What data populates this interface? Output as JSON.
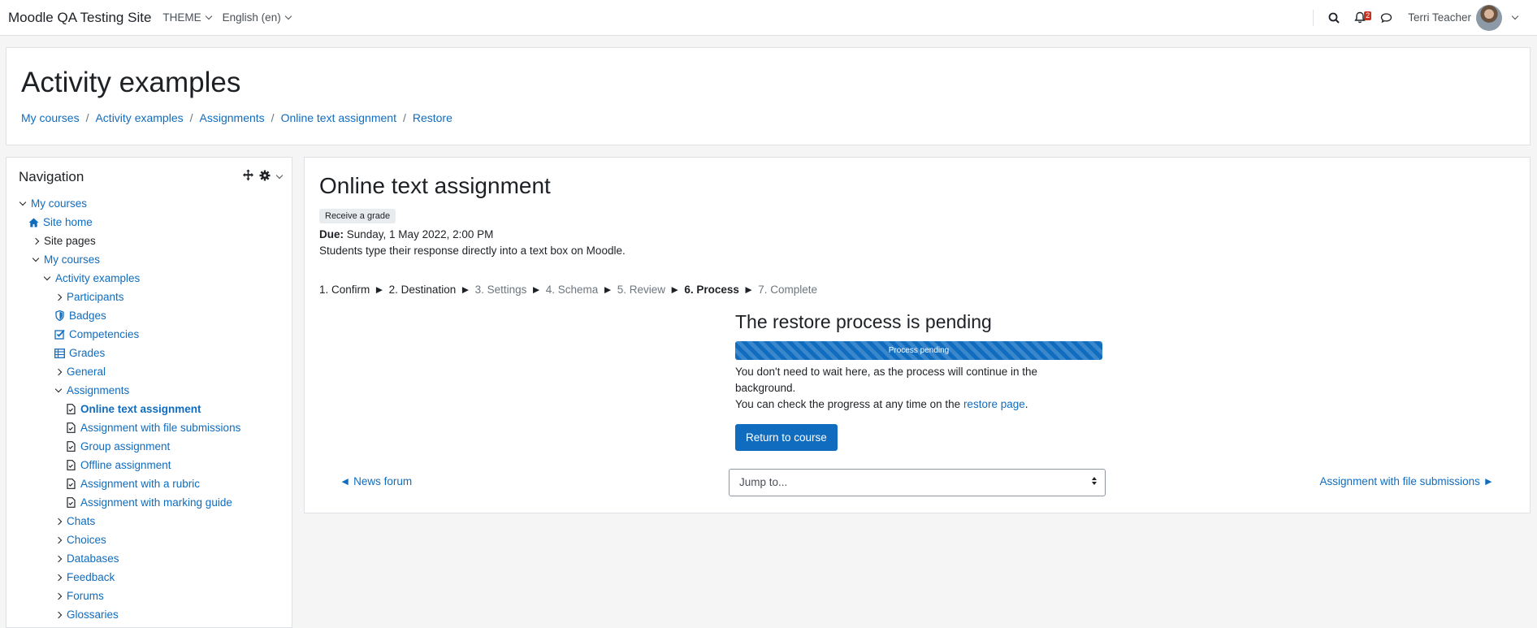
{
  "navbar": {
    "site_name": "Moodle QA Testing Site",
    "theme_menu": "THEME",
    "language_menu": "English (en)",
    "notification_count": "2",
    "user_name": "Terri Teacher",
    "accent_badge_color": "#ca3120"
  },
  "header": {
    "title": "Activity examples",
    "breadcrumb": [
      "My courses",
      "Activity examples",
      "Assignments",
      "Online text assignment",
      "Restore"
    ]
  },
  "navigation": {
    "title": "Navigation",
    "items": [
      {
        "label": "My courses",
        "icon": "chevron-down"
      },
      {
        "label": "Site home",
        "icon": "home-icon"
      },
      {
        "label": "Site pages",
        "icon": "chevron-right"
      },
      {
        "label": "My courses",
        "icon": "chevron-down"
      },
      {
        "label": "Activity examples",
        "icon": "chevron-down"
      },
      {
        "label": "Participants",
        "icon": "chevron-right"
      },
      {
        "label": "Badges",
        "icon": "shield-icon"
      },
      {
        "label": "Competencies",
        "icon": "checkbox-icon"
      },
      {
        "label": "Grades",
        "icon": "table-icon"
      },
      {
        "label": "General",
        "icon": "chevron-right"
      },
      {
        "label": "Assignments",
        "icon": "chevron-down"
      },
      {
        "label": "Online text assignment",
        "icon": "assignment-icon"
      },
      {
        "label": "Assignment with file submissions",
        "icon": "assignment-icon"
      },
      {
        "label": "Group assignment",
        "icon": "assignment-icon"
      },
      {
        "label": "Offline assignment",
        "icon": "assignment-icon"
      },
      {
        "label": "Assignment with a rubric",
        "icon": "assignment-icon"
      },
      {
        "label": "Assignment with marking guide",
        "icon": "assignment-icon"
      },
      {
        "label": "Chats",
        "icon": "chevron-right"
      },
      {
        "label": "Choices",
        "icon": "chevron-right"
      },
      {
        "label": "Databases",
        "icon": "chevron-right"
      },
      {
        "label": "Feedback",
        "icon": "chevron-right"
      },
      {
        "label": "Forums",
        "icon": "chevron-right"
      },
      {
        "label": "Glossaries",
        "icon": "chevron-right"
      }
    ]
  },
  "main": {
    "title": "Online text assignment",
    "grade_badge": "Receive a grade",
    "due_label": "Due:",
    "due_value": "Sunday, 1 May 2022, 2:00 PM",
    "description": "Students type their response directly into a text box on Moodle.",
    "steps": [
      {
        "label": "1. Confirm",
        "state": "done"
      },
      {
        "label": "2. Destination",
        "state": "done"
      },
      {
        "label": "3. Settings",
        "state": "future"
      },
      {
        "label": "4. Schema",
        "state": "future"
      },
      {
        "label": "5. Review",
        "state": "future"
      },
      {
        "label": "6. Process",
        "state": "current"
      },
      {
        "label": "7. Complete",
        "state": "future"
      }
    ],
    "step_separator": "►",
    "pending_title": "The restore process is pending",
    "progress_label": "Process pending",
    "pending_line1": "You don't need to wait here, as the process will continue in the background.",
    "pending_line2_prefix": "You can check the progress at any time on the",
    "pending_link": "restore page",
    "pending_line2_suffix": ".",
    "return_button": "Return to course",
    "prev_link": "◄ News forum",
    "jump_placeholder": "Jump to...",
    "next_link": "Assignment with file submissions ►"
  }
}
